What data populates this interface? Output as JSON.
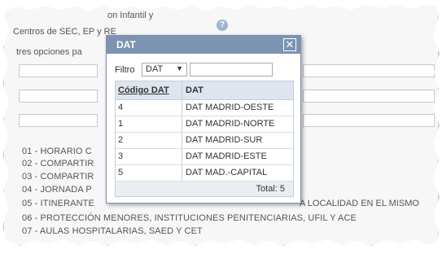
{
  "background": {
    "top_fragment": "on Infantil y",
    "centros_line": "Centros de SEC, EP y RE",
    "opciones_line": "tres opciones pa",
    "list_items": [
      "01 - HORARIO C",
      "02 - COMPARTIR",
      "03 - COMPARTIR",
      "04 - JORNADA P",
      "05 - ITINERANTE",
      "06 - PROTECCIÓN MENORES, INSTITUCIONES PENITENCIARIAS, UFIL Y ACE",
      "07 - AULAS HOSPITALARIAS, SAED Y CET"
    ],
    "item5_tail": "A LOCALIDAD EN EL MISMO"
  },
  "dialog": {
    "title": "DAT",
    "close_glyph": "✕",
    "filter_label": "Filtro",
    "filter_select_value": "DAT",
    "filter_input_value": "",
    "columns": [
      "Código DAT",
      "DAT"
    ],
    "rows": [
      {
        "code": "4",
        "name": "DAT MADRID-OESTE"
      },
      {
        "code": "1",
        "name": "DAT MADRID-NORTE"
      },
      {
        "code": "2",
        "name": "DAT MADRID-SUR"
      },
      {
        "code": "3",
        "name": "DAT MADRID-ESTE"
      },
      {
        "code": "5",
        "name": "DAT MAD.-CAPITAL"
      }
    ],
    "total_label": "Total: 5"
  },
  "icons": {
    "help": "question-icon",
    "close": "close-icon",
    "dropdown": "dropdown-arrow-icon"
  },
  "colors": {
    "titlebar": "#7d93b2",
    "header": "#dfe5ee"
  }
}
